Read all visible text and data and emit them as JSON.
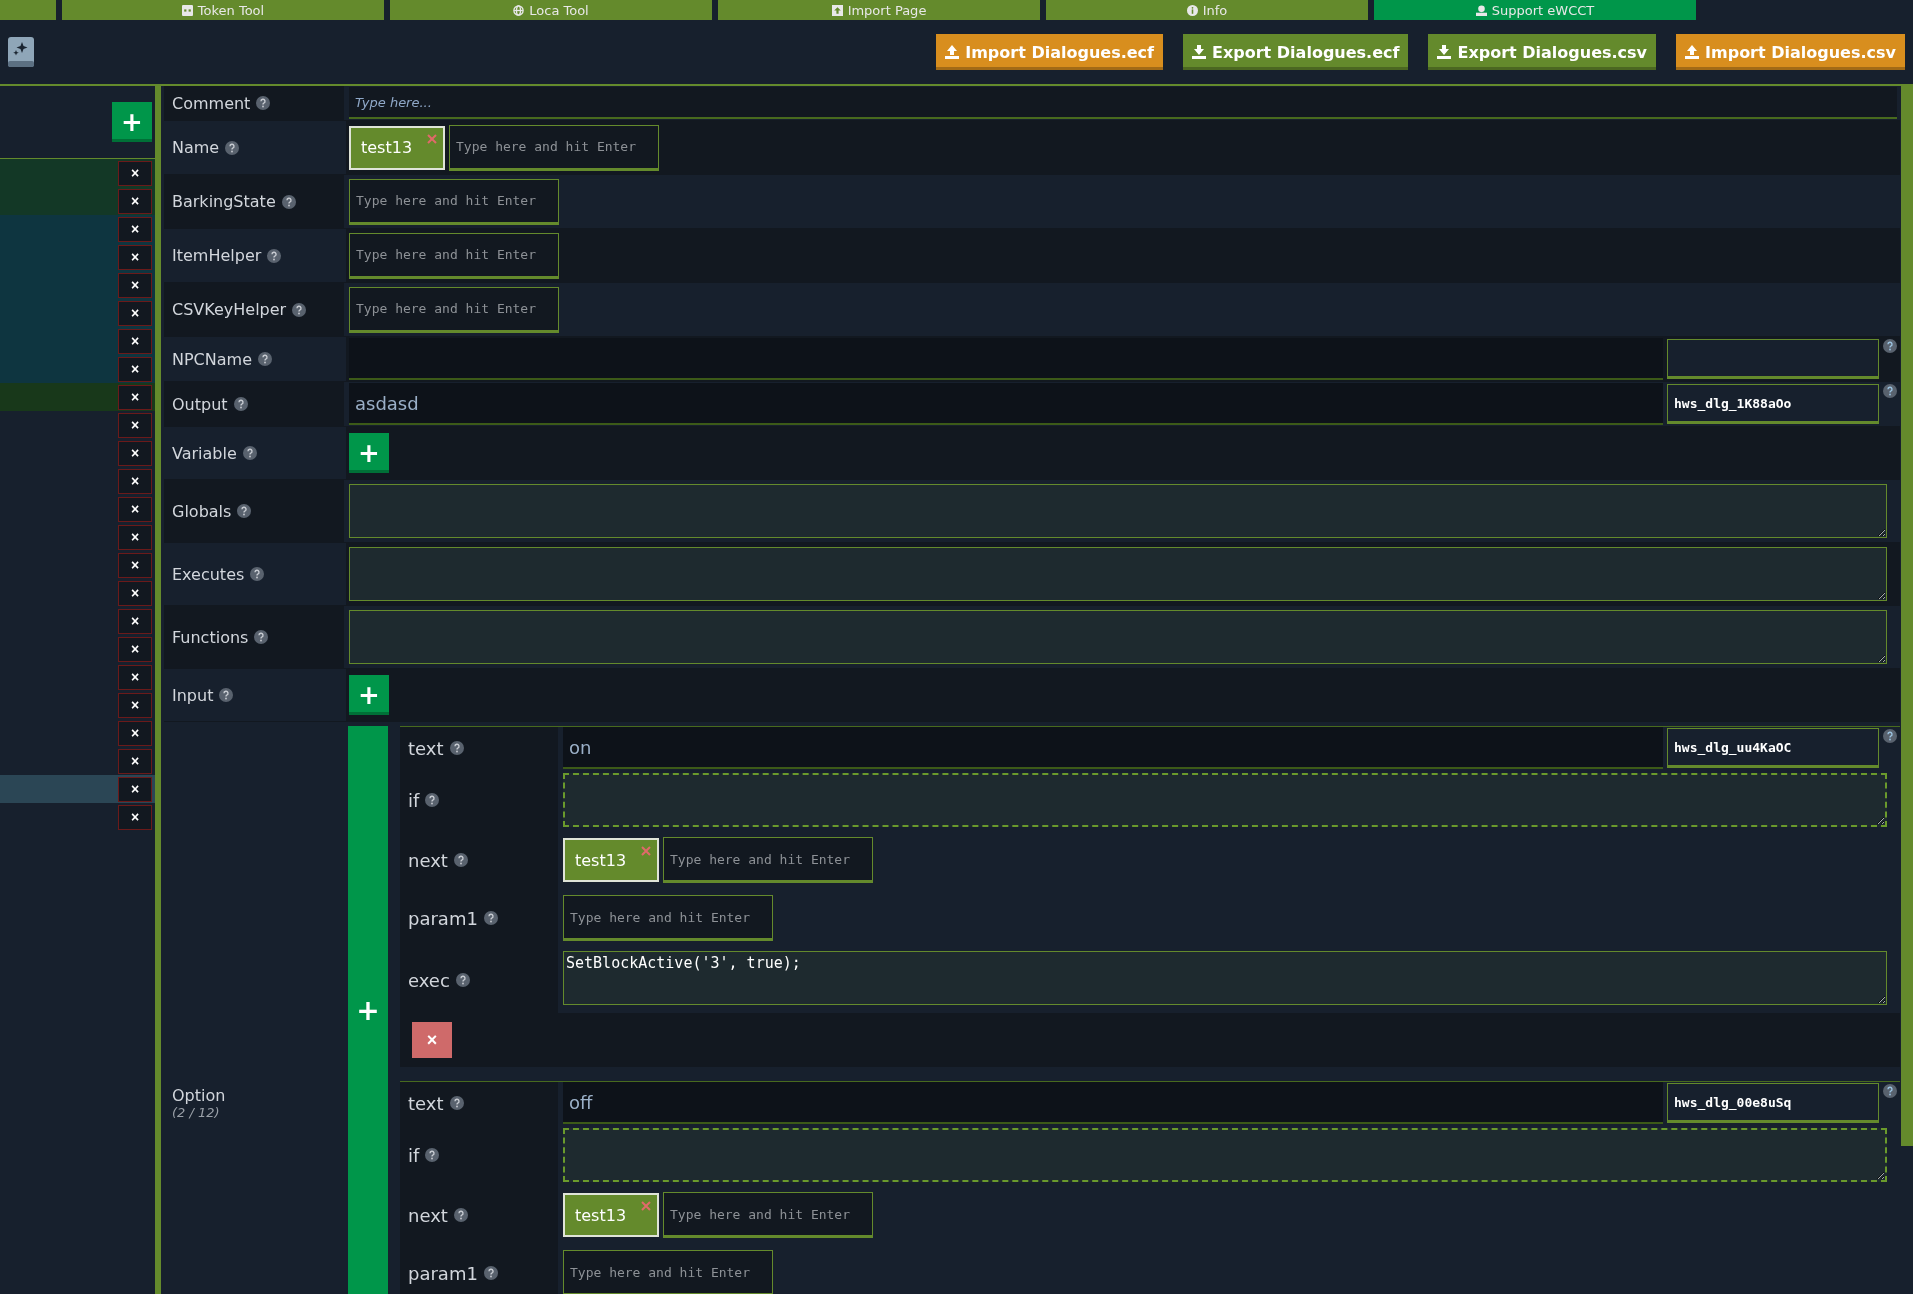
{
  "tabs": [
    {
      "label": "Token Tool",
      "kind": "token",
      "selected": false
    },
    {
      "label": "Loca Tool",
      "kind": "loca",
      "selected": false
    },
    {
      "label": "Import Page",
      "kind": "import",
      "selected": false
    },
    {
      "label": "Info",
      "kind": "info",
      "selected": false
    },
    {
      "label": "Support eWCCT",
      "kind": "support",
      "selected": true
    }
  ],
  "toolbar": {
    "buttons": [
      {
        "label": "Import Dialogues.ecf",
        "kind": "import"
      },
      {
        "label": "Export Dialogues.ecf",
        "kind": "export"
      },
      {
        "label": "Export Dialogues.csv",
        "kind": "export"
      },
      {
        "label": "Import Dialogues.csv",
        "kind": "import"
      }
    ]
  },
  "sidebar": {
    "add": "+",
    "rows": [
      {
        "color": "#133826",
        "selected": false,
        "button": "×"
      },
      {
        "color": "#133826",
        "selected": false,
        "button": "×"
      },
      {
        "color": "#0e3540",
        "selected": false,
        "button": "×"
      },
      {
        "color": "#0e3540",
        "selected": false,
        "button": "×"
      },
      {
        "color": "#0e3540",
        "selected": false,
        "button": "×"
      },
      {
        "color": "#0e3540",
        "selected": false,
        "button": "×"
      },
      {
        "color": "#0e3540",
        "selected": false,
        "button": "×"
      },
      {
        "color": "#0e3540",
        "selected": false,
        "button": "×"
      },
      {
        "color": "#18381a",
        "selected": false,
        "button": "×"
      },
      {
        "selected": false,
        "button": "×"
      },
      {
        "selected": false,
        "button": "×"
      },
      {
        "selected": false,
        "button": "×"
      },
      {
        "selected": false,
        "button": "×"
      },
      {
        "selected": false,
        "button": "×"
      },
      {
        "selected": false,
        "button": "×"
      },
      {
        "selected": false,
        "button": "×"
      },
      {
        "selected": false,
        "button": "×"
      },
      {
        "selected": false,
        "button": "×"
      },
      {
        "selected": false,
        "button": "×"
      },
      {
        "selected": false,
        "button": "×"
      },
      {
        "selected": false,
        "button": "×"
      },
      {
        "selected": false,
        "button": "×"
      },
      {
        "selected": true,
        "button": "×"
      },
      {
        "selected": false,
        "button": "×"
      }
    ]
  },
  "form": {
    "fields": [
      {
        "label": "Comment",
        "kind": "text",
        "placeholder": "Type here..."
      },
      {
        "label": "Name",
        "kind": "tags",
        "tags": [
          "test13"
        ],
        "placeholder": "Type here and hit Enter"
      },
      {
        "label": "BarkingState",
        "kind": "tags",
        "placeholder": "Type here and hit Enter"
      },
      {
        "label": "ItemHelper",
        "kind": "tags",
        "placeholder": "Type here and hit Enter"
      },
      {
        "label": "CSVKeyHelper",
        "kind": "tags",
        "placeholder": "Type here and hit Enter"
      },
      {
        "label": "NPCName",
        "kind": "keyed"
      },
      {
        "label": "Output",
        "kind": "keyed",
        "value": "asdasd",
        "key": "hws_dlg_1K88aOo"
      },
      {
        "label": "Variable",
        "kind": "add",
        "add": "+"
      },
      {
        "label": "Globals",
        "kind": "area"
      },
      {
        "label": "Executes",
        "kind": "area"
      },
      {
        "label": "Functions",
        "kind": "area"
      },
      {
        "label": "Input",
        "kind": "add",
        "add": "+"
      }
    ]
  },
  "option": {
    "label": "Option",
    "count": "(2 / 12)",
    "add": "+",
    "items": [
      {
        "delete": "×",
        "fields": [
          {
            "label": "text",
            "kind": "keyed",
            "value": "on",
            "key": "hws_dlg_uu4KaOC"
          },
          {
            "label": "if",
            "kind": "condition"
          },
          {
            "label": "next",
            "kind": "tags",
            "tags": [
              "test13"
            ],
            "placeholder": "Type here and hit Enter"
          },
          {
            "label": "param1",
            "kind": "tags",
            "placeholder": "Type here and hit Enter"
          },
          {
            "label": "exec",
            "kind": "area",
            "value": "SetBlockActive('3', true);"
          }
        ]
      },
      {
        "fields": [
          {
            "label": "text",
            "kind": "keyed",
            "value": "off",
            "key": "hws_dlg_00e8uSq"
          },
          {
            "label": "if",
            "kind": "condition"
          },
          {
            "label": "next",
            "kind": "tags",
            "tags": [
              "test13"
            ],
            "placeholder": "Type here and hit Enter"
          },
          {
            "label": "param1",
            "kind": "tags",
            "placeholder": "Type here and hit Enter"
          }
        ]
      }
    ]
  }
}
